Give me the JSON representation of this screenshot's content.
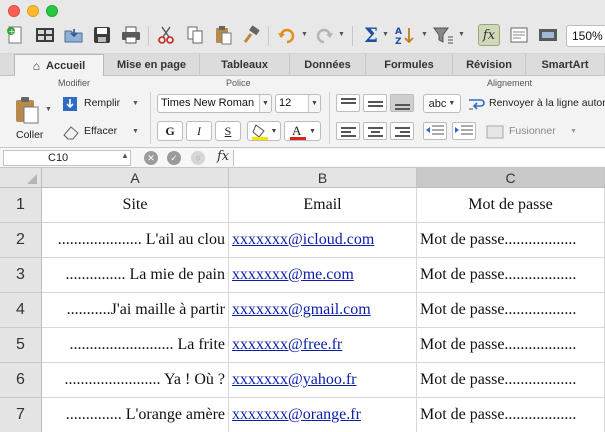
{
  "toolbar": {
    "zoom": "150%",
    "icons": [
      "new-document-icon",
      "gallery-icon",
      "open-folder-icon",
      "save-icon",
      "print-icon",
      "cut-icon",
      "copy-icon",
      "paste-icon",
      "format-painter-icon",
      "undo-icon",
      "redo-icon",
      "autosum-icon",
      "sort-icon",
      "filter-icon",
      "function-icon",
      "show-formula-icon",
      "media-icon"
    ]
  },
  "tabs": [
    "Accueil",
    "Mise en page",
    "Tableaux",
    "Données",
    "Formules",
    "Révision",
    "SmartArt"
  ],
  "ribbon": {
    "groups": {
      "modifier": "Modifier",
      "police": "Police",
      "alignement": "Alignement"
    },
    "coller": "Coller",
    "remplir": "Remplir",
    "effacer": "Effacer",
    "font_name": "Times New Roman",
    "font_size": "12",
    "bold": "G",
    "italic": "I",
    "underline": "S",
    "text_orientation": "abc",
    "wrap_text": "Renvoyer à la ligne automatiquement",
    "merge": "Fusionner"
  },
  "formula_bar": {
    "cell_ref": "C10",
    "fx": "fx",
    "value": ""
  },
  "sheet": {
    "columns": [
      "A",
      "B",
      "C"
    ],
    "selected_column": "C",
    "rows": [
      {
        "num": "1",
        "a": "Site",
        "b": "Email",
        "c": "Mot de passe"
      },
      {
        "num": "2",
        "a": "..................... L'ail au clou",
        "b": "xxxxxxx@icloud.com",
        "c": "Mot de passe.................."
      },
      {
        "num": "3",
        "a": "............... La mie de pain",
        "b": "xxxxxxx@me.com",
        "c": "Mot de passe.................."
      },
      {
        "num": "4",
        "a": "...........J'ai maille à partir",
        "b": "xxxxxxx@gmail.com",
        "c": "Mot de passe.................."
      },
      {
        "num": "5",
        "a": "..........................  La frite",
        "b": "xxxxxxx@free.fr",
        "c": "Mot de passe.................."
      },
      {
        "num": "6",
        "a": "........................  Ya ! Où ?",
        "b": "xxxxxxx@yahoo.fr",
        "c": "Mot de passe.................."
      },
      {
        "num": "7",
        "a": "..............  L'orange amère",
        "b": "xxxxxxx@orange.fr",
        "c": "Mot de passe.................."
      }
    ]
  },
  "colors": {
    "link": "#0b1ea8",
    "header_bg": "#e4e4e4",
    "selected_header_bg": "#c9c9c9",
    "font_color_underline": "#e0201b",
    "highlight_underline": "#f5e400"
  }
}
